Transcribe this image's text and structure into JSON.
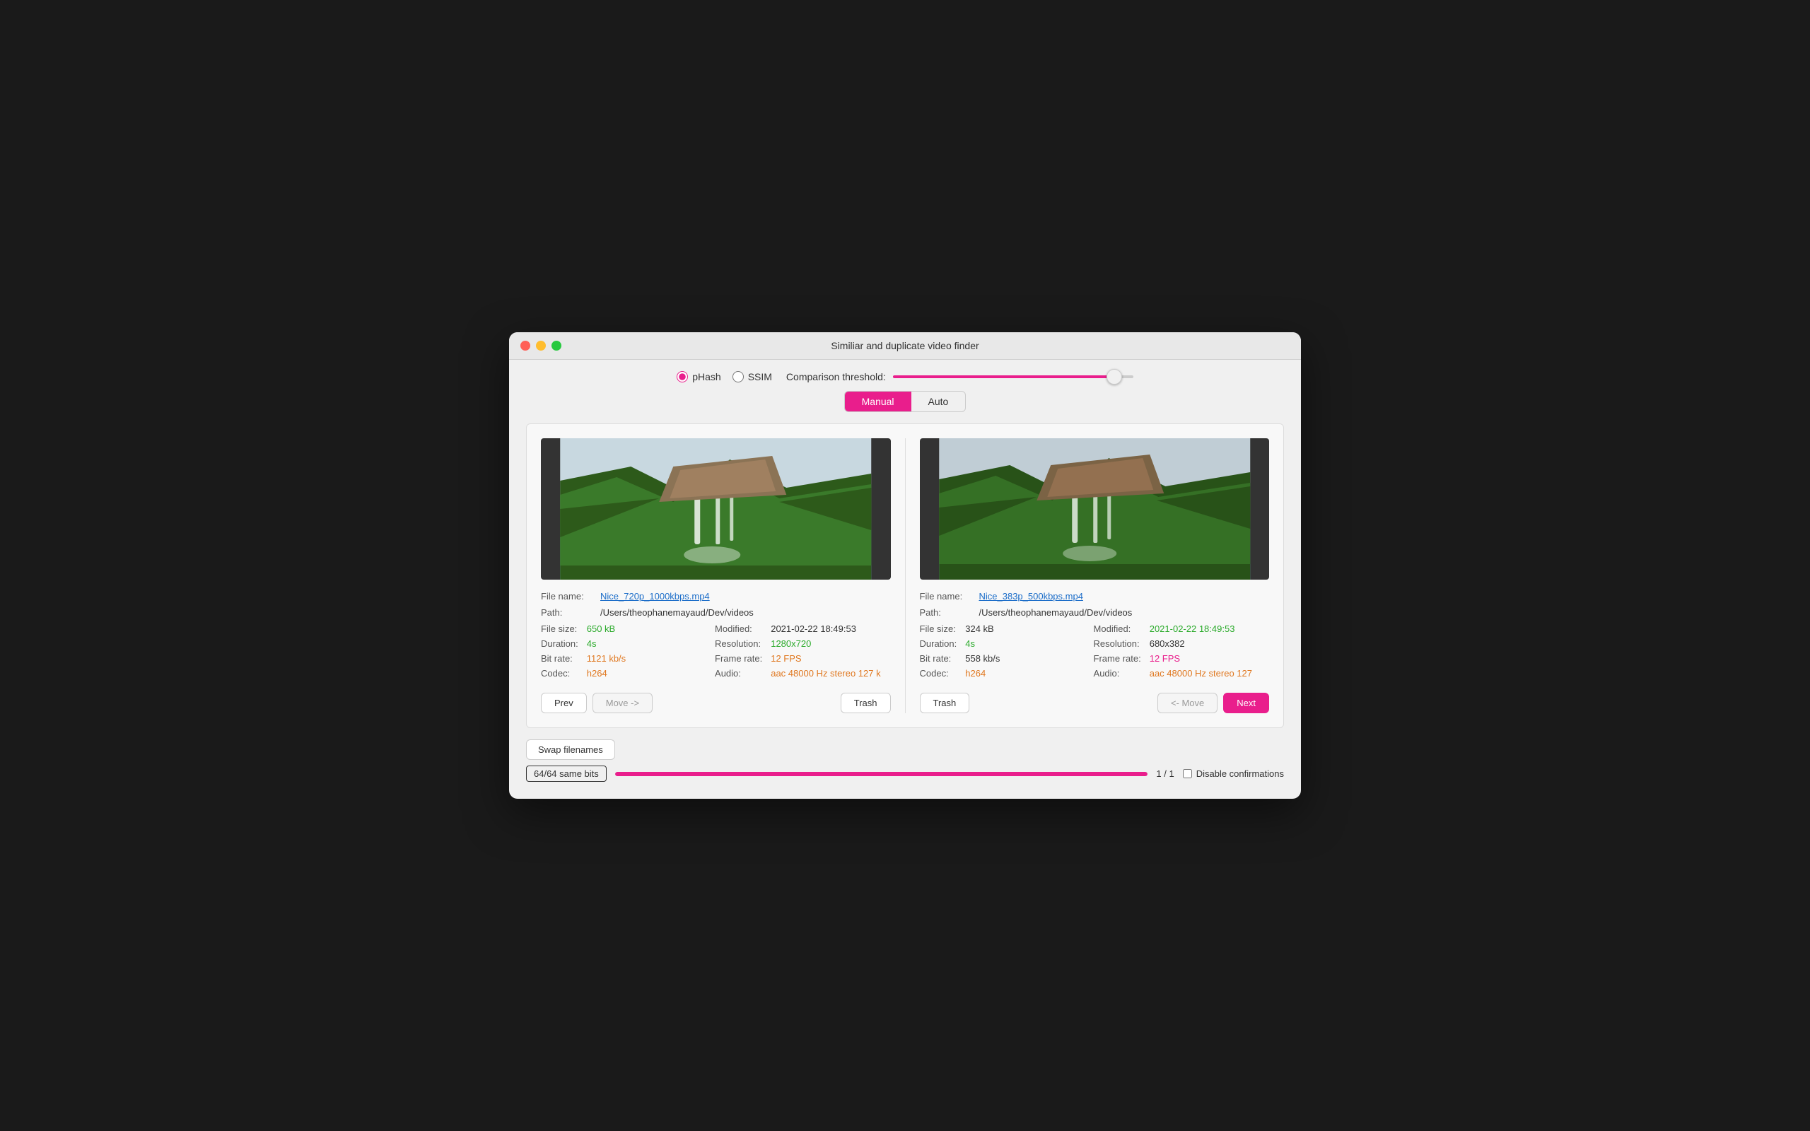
{
  "window": {
    "title": "Similiar and duplicate video finder"
  },
  "toolbar": {
    "phash_label": "pHash",
    "ssim_label": "SSIM",
    "threshold_label": "Comparison threshold:",
    "manual_label": "Manual",
    "auto_label": "Auto",
    "threshold_value": 95
  },
  "left_video": {
    "filename": "Nice_720p_1000kbps.mp4",
    "path": "/Users/theophanemayaud/Dev/videos",
    "filesize": "650 kB",
    "modified": "2021-02-22 18:49:53",
    "duration": "4s",
    "resolution": "1280x720",
    "bitrate": "1121 kb/s",
    "framerate": "12 FPS",
    "codec": "h264",
    "audio": "aac 48000 Hz stereo 127 k"
  },
  "right_video": {
    "filename": "Nice_383p_500kbps.mp4",
    "path": "/Users/theophanemayaud/Dev/videos",
    "filesize": "324 kB",
    "modified": "2021-02-22 18:49:53",
    "duration": "4s",
    "resolution": "680x382",
    "bitrate": "558 kb/s",
    "framerate": "12 FPS",
    "codec": "h264",
    "audio": "aac 48000 Hz stereo 127"
  },
  "buttons": {
    "prev": "Prev",
    "move_right": "Move ->",
    "trash_left": "Trash",
    "trash_right": "Trash",
    "move_left": "<- Move",
    "next": "Next",
    "swap": "Swap filenames"
  },
  "status": {
    "same_bits": "64/64 same bits",
    "page": "1 / 1",
    "disable_confirmations": "Disable confirmations",
    "progress_percent": 100
  }
}
